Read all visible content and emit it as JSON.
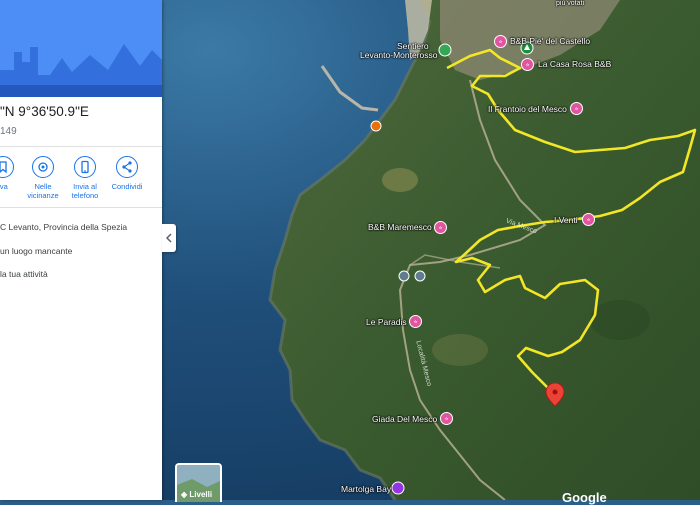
{
  "panel": {
    "coords": "\"N 9°36'50.9\"E",
    "subcoord": "149",
    "actions": [
      {
        "label": "lva",
        "icon": "bookmark-icon"
      },
      {
        "label": "Nelle vicinanze",
        "icon": "nearby-icon"
      },
      {
        "label": "Invia al telefono",
        "icon": "phone-icon"
      },
      {
        "label": "Condividi",
        "icon": "share-icon"
      }
    ],
    "info": [
      "C Levanto, Provincia della Spezia",
      "un luogo mancante",
      "la tua attività"
    ]
  },
  "map": {
    "places": {
      "sentiero": "Sentiero",
      "levanto_monterosso": "Levanto-Monterosso",
      "bb_castello": "B&B Pie' del Castello",
      "casa_rosa": "La Casa Rosa B&B",
      "frantoio": "Il Frantoio del Mesco",
      "bb_maremesco": "B&B Maremesco",
      "i_venti": "I Venti",
      "le_paradis": "Le Paradis",
      "giada": "Giada Del Mesco",
      "martolga": "Martolga Bay",
      "piu_votati": "più votati"
    },
    "roads": {
      "via_mesco": "Via Mesco",
      "localita_mesco": "Località Mesco"
    },
    "layers_label": "Livelli",
    "attribution": "Google",
    "colors": {
      "trail": "#f2e626",
      "pin": "#e055a0",
      "marker": "#ea4335",
      "accent": "#1a73e8"
    }
  }
}
